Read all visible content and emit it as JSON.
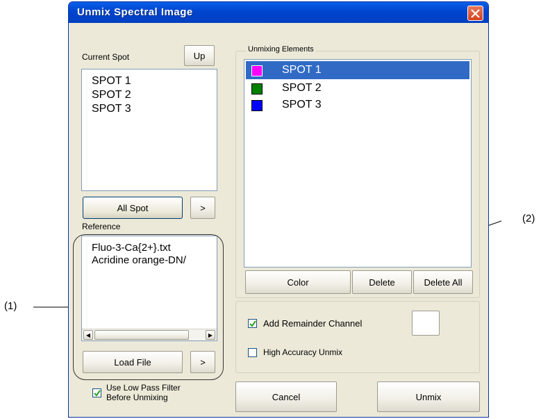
{
  "window": {
    "title": "Unmix Spectral Image"
  },
  "current_spot": {
    "label": "Current Spot",
    "up_button": "Up",
    "items": [
      "SPOT  1",
      "SPOT  2",
      "SPOT  3"
    ],
    "all_spot_button": "All Spot",
    "move_button": ">"
  },
  "reference": {
    "label": "Reference",
    "items": [
      "Fluo-3-Ca{2+}.txt",
      "Acridine orange-DN/"
    ],
    "load_button": "Load File",
    "move_button": ">"
  },
  "low_pass_filter": {
    "label": "Use Low Pass Filter\nBefore Unmixing",
    "checked": true
  },
  "unmixing": {
    "label": "Unmixing Elements",
    "items": [
      {
        "name": "SPOT  1",
        "color": "#ff00ff",
        "selected": true
      },
      {
        "name": "SPOT  2",
        "color": "#008000",
        "selected": false
      },
      {
        "name": "SPOT  3",
        "color": "#0000ff",
        "selected": false
      }
    ],
    "color_button": "Color",
    "delete_button": "Delete",
    "delete_all_button": "Delete All"
  },
  "options": {
    "add_remainder": {
      "label": "Add Remainder Channel",
      "checked": true
    },
    "high_accuracy": {
      "label": "High Accuracy Unmix",
      "checked": false
    }
  },
  "footer": {
    "cancel": "Cancel",
    "unmix": "Unmix"
  },
  "callouts": {
    "one": "(1)",
    "two": "(2)"
  },
  "colors": {
    "titlebar": "#0044cf",
    "selection": "#316ac5",
    "face": "#ece9d8"
  }
}
